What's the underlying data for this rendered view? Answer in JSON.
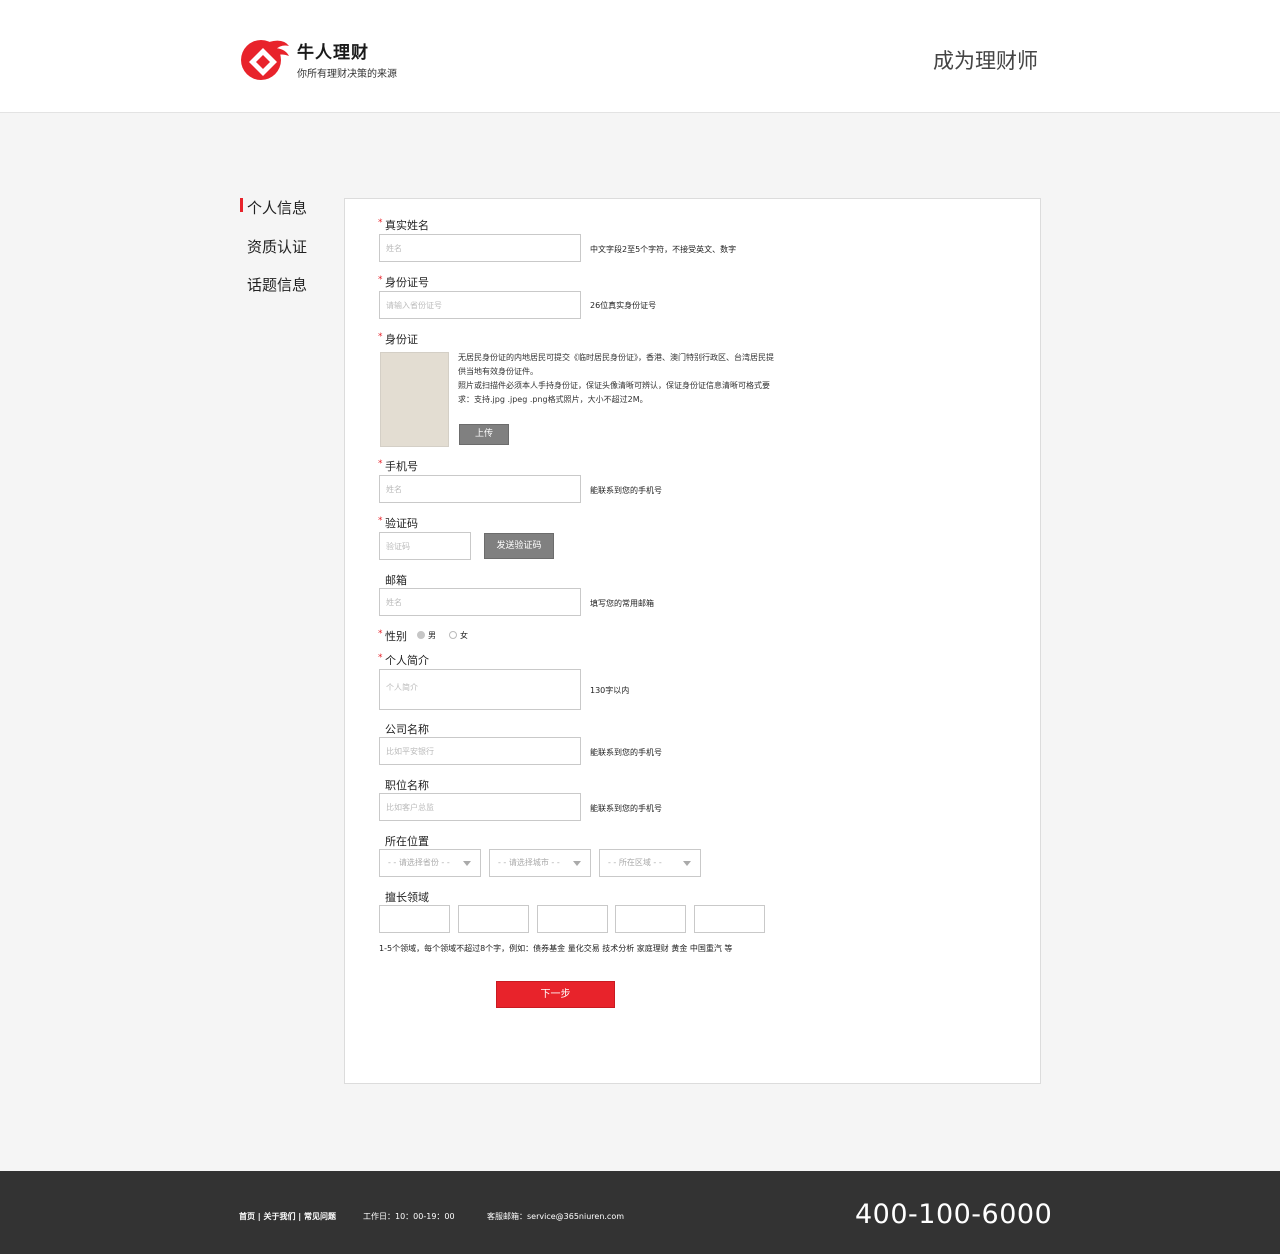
{
  "header": {
    "logo_name": "牛人理财",
    "logo_slogan": "你所有理财决策的来源",
    "title": "成为理财师"
  },
  "colors": {
    "accent": "#e8232b",
    "footer_bg": "#333333",
    "gray_button": "#808080"
  },
  "sidebar": {
    "items": [
      {
        "label": "个人信息",
        "active": true
      },
      {
        "label": "资质认证",
        "active": false
      },
      {
        "label": "话题信息",
        "active": false
      }
    ]
  },
  "form": {
    "real_name": {
      "label": "真实姓名",
      "placeholder": "姓名",
      "hint": "中文字段2至5个字符，不接受英文、数字"
    },
    "id_number": {
      "label": "身份证号",
      "placeholder": "请输入省份证号",
      "hint": "26位真实身份证号"
    },
    "id_card": {
      "label": "身份证",
      "note_line1": "无居民身份证的内地居民可提交《临时居民身份证》，香港、澳门特别行政区、台湾居民提供当地有效身份证件。",
      "note_line2": "照片或扫描件必须本人手持身份证，保证头像清晰可辨认，保证身份证信息清晰可格式要求：支持.jpg .jpeg .png格式照片，大小不超过2M。",
      "upload_label": "上传"
    },
    "phone": {
      "label": "手机号",
      "placeholder": "姓名",
      "hint": "能联系到您的手机号"
    },
    "verify_code": {
      "label": "验证码",
      "placeholder": "验证码",
      "send_label": "发送验证码"
    },
    "email": {
      "label": "邮箱",
      "placeholder": "姓名",
      "hint": "填写您的常用邮箱"
    },
    "gender": {
      "label": "性别",
      "male": "男",
      "female": "女",
      "selected": "男"
    },
    "bio": {
      "label": "个人简介",
      "placeholder": "个人简介",
      "hint": "130字以内"
    },
    "company": {
      "label": "公司名称",
      "placeholder": "比如平安银行",
      "hint": "能联系到您的手机号"
    },
    "position": {
      "label": "职位名称",
      "placeholder": "比如客户总监",
      "hint": "能联系到您的手机号"
    },
    "location": {
      "label": "所在位置",
      "province": "- - 请选择省份 - -",
      "city": "- - 请选择城市 - -",
      "district": "- - 所在区域 - -"
    },
    "expertise": {
      "label": "擅长领域",
      "hint": "1-5个领域，每个领域不超过8个字，例如：债券基金 量化交易 技术分析 家庭理财 黄金 中国重汽 等"
    },
    "next_label": "下一步"
  },
  "footer": {
    "links": [
      "首页",
      "关于我们",
      "常见问题"
    ],
    "separator": " | ",
    "hours": "工作日：10：00-19：00",
    "email": "客服邮箱：service@365niuren.com",
    "phone": "400-100-6000"
  }
}
